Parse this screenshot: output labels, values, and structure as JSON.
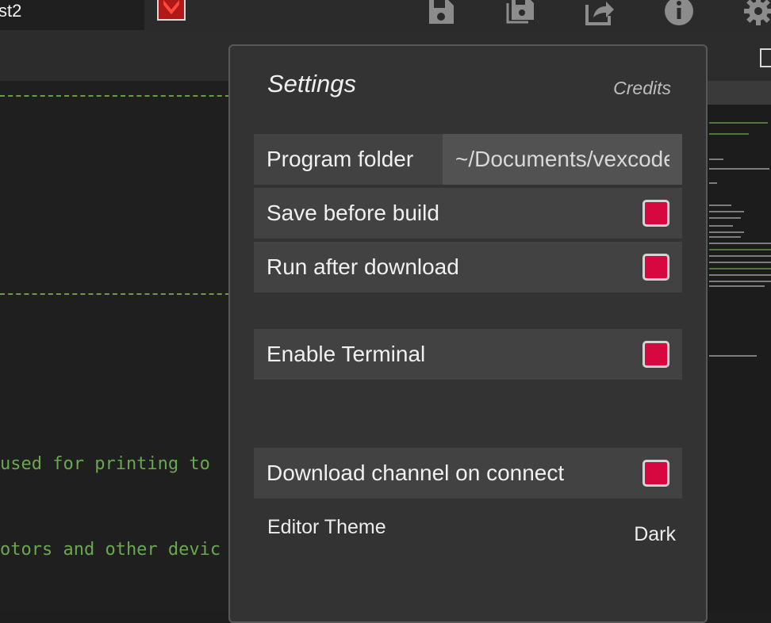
{
  "toolbar": {
    "tab_label": "st2",
    "icons": [
      "save-icon",
      "save-as-icon",
      "export-icon",
      "info-icon",
      "gear-icon"
    ]
  },
  "editor": {
    "code_lines": [
      "used for printing to",
      "otors and other devic"
    ]
  },
  "settings": {
    "title": "Settings",
    "credits": "Credits",
    "program_folder_label": "Program folder",
    "program_folder_value": "~/Documents/vexcode",
    "save_before_build_label": "Save before build",
    "run_after_download_label": "Run after download",
    "enable_terminal_label": "Enable Terminal",
    "download_channel_label": "Download channel on connect",
    "editor_theme_label": "Editor Theme",
    "editor_theme_value": "Dark",
    "checked_color": "#d6083f"
  }
}
